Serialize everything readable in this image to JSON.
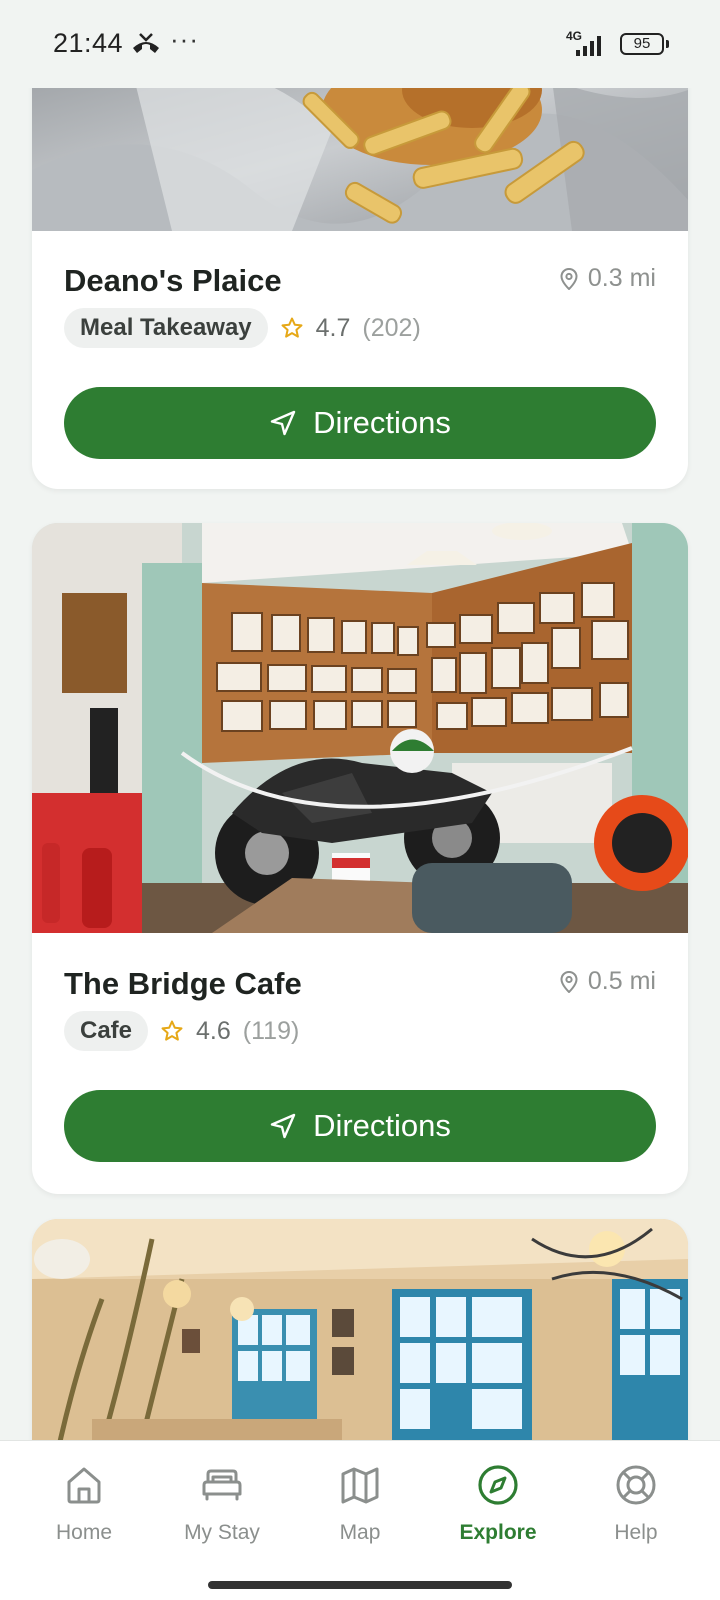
{
  "status_bar": {
    "time": "21:44",
    "network": "4G",
    "battery": "95",
    "icons": [
      "missed-call-icon",
      "more-dots-icon",
      "signal-icon",
      "battery-icon"
    ]
  },
  "places": [
    {
      "name": "Deano's Plaice",
      "distance": "0.3 mi",
      "category": "Meal Takeaway",
      "rating": "4.7",
      "reviews": "(202)",
      "directions_label": "Directions",
      "image": "fish-and-chips-photo"
    },
    {
      "name": "The Bridge Cafe",
      "distance": "0.5 mi",
      "category": "Cafe",
      "rating": "4.6",
      "reviews": "(119)",
      "directions_label": "Directions",
      "image": "motorbike-cafe-interior-photo"
    },
    {
      "image": "tearoom-interior-photo"
    }
  ],
  "bottom_nav": {
    "items": [
      {
        "label": "Home",
        "icon": "home-icon"
      },
      {
        "label": "My Stay",
        "icon": "bed-icon"
      },
      {
        "label": "Map",
        "icon": "map-icon"
      },
      {
        "label": "Explore",
        "icon": "compass-icon",
        "active": true
      },
      {
        "label": "Help",
        "icon": "lifebuoy-icon"
      }
    ]
  },
  "colors": {
    "accent": "#2e7d32",
    "background": "#f1f4f2",
    "star": "#e6a817",
    "muted_text": "#8e918f"
  }
}
